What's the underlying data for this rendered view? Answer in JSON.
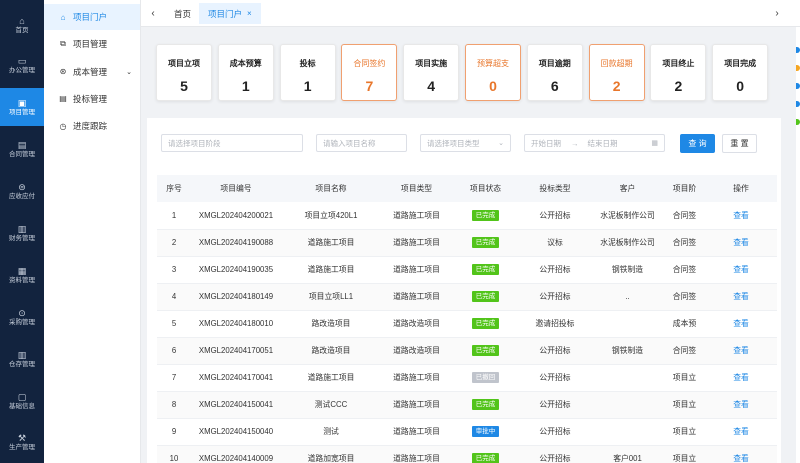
{
  "rail": [
    {
      "icon": "⌂",
      "label": "首页",
      "name": "rail-home",
      "icon_name": "home-icon"
    },
    {
      "icon": "▭",
      "label": "办公管理",
      "name": "rail-office",
      "icon_name": "monitor-icon"
    },
    {
      "icon": "▣",
      "label": "项目管理",
      "name": "rail-project",
      "icon_name": "project-icon",
      "active": true
    },
    {
      "icon": "▤",
      "label": "合同管理",
      "name": "rail-contract",
      "icon_name": "contract-icon"
    },
    {
      "icon": "⊜",
      "label": "应收应付",
      "name": "rail-receivable",
      "icon_name": "money-icon"
    },
    {
      "icon": "▥",
      "label": "财务管理",
      "name": "rail-finance",
      "icon_name": "finance-icon"
    },
    {
      "icon": "▦",
      "label": "资料管理",
      "name": "rail-documents",
      "icon_name": "folder-icon"
    },
    {
      "icon": "⊙",
      "label": "采购管理",
      "name": "rail-purchase",
      "icon_name": "purchase-icon"
    },
    {
      "icon": "▥",
      "label": "仓存管理",
      "name": "rail-warehouse",
      "icon_name": "warehouse-icon"
    },
    {
      "icon": "▢",
      "label": "基础信息",
      "name": "rail-basic",
      "icon_name": "info-icon"
    },
    {
      "icon": "⚒",
      "label": "生产管理",
      "name": "rail-production",
      "icon_name": "tool-icon"
    }
  ],
  "menu": [
    {
      "icon": "⌂",
      "label": "项目门户",
      "name": "menu-portal",
      "icon_name": "home-icon",
      "active": true
    },
    {
      "icon": "⧉",
      "label": "项目管理",
      "name": "menu-project",
      "icon_name": "copy-icon"
    },
    {
      "icon": "⊛",
      "label": "成本管理",
      "name": "menu-cost",
      "icon_name": "cost-icon",
      "chevron": "⌄"
    },
    {
      "icon": "▤",
      "label": "投标管理",
      "name": "menu-bidding",
      "icon_name": "bid-icon"
    },
    {
      "icon": "◷",
      "label": "进度跟踪",
      "name": "menu-progress",
      "icon_name": "clock-icon"
    }
  ],
  "tabs": {
    "left_arrow": "‹",
    "right_arrow": "›",
    "items": [
      {
        "label": "首页"
      },
      {
        "label": "项目门户",
        "close": "×",
        "active": true
      }
    ]
  },
  "kpis": [
    {
      "label": "项目立项",
      "value": "5"
    },
    {
      "label": "成本预算",
      "value": "1"
    },
    {
      "label": "投标",
      "value": "1"
    },
    {
      "label": "合同签约",
      "value": "7",
      "warn": true
    },
    {
      "label": "项目实施",
      "value": "4"
    },
    {
      "label": "预算超支",
      "value": "0",
      "warn": true
    },
    {
      "label": "项目逾期",
      "value": "6"
    },
    {
      "label": "回款超期",
      "value": "2",
      "warn": true
    },
    {
      "label": "项目终止",
      "value": "2"
    },
    {
      "label": "项目完成",
      "value": "0"
    }
  ],
  "filters": {
    "stage_placeholder": "请选择项目阶段",
    "name_placeholder": "请输入项目名称",
    "type_placeholder": "请选择项目类型",
    "type_caret": "⌄",
    "start_placeholder": "开始日期",
    "range_arrow": "→",
    "end_placeholder": "结束日期",
    "calendar_icon": "▦",
    "search_label": "查 询",
    "reset_label": "重 置"
  },
  "table": {
    "headers": [
      "序号",
      "项目编号",
      "项目名称",
      "项目类型",
      "项目状态",
      "投标类型",
      "客户",
      "项目阶",
      "操作"
    ],
    "rows": [
      {
        "no": "1",
        "code": "XMGL202404200021",
        "name": "项目立项420L1",
        "type": "道路施工项目",
        "status": "已完成",
        "status_color": "#52c41a",
        "bid": "公开招标",
        "customer": "水泥板制作公司",
        "stage": "合同签",
        "op": "查看"
      },
      {
        "no": "2",
        "code": "XMGL202404190088",
        "name": "道路施工项目",
        "type": "道路施工项目",
        "status": "已完成",
        "status_color": "#52c41a",
        "bid": "议标",
        "customer": "水泥板制作公司",
        "stage": "合同签",
        "op": "查看"
      },
      {
        "no": "3",
        "code": "XMGL202404190035",
        "name": "道路施工项目",
        "type": "道路施工项目",
        "status": "已完成",
        "status_color": "#52c41a",
        "bid": "公开招标",
        "customer": "钢铁制造",
        "stage": "合同签",
        "op": "查看"
      },
      {
        "no": "4",
        "code": "XMGL202404180149",
        "name": "项目立项LL1",
        "type": "道路施工项目",
        "status": "已完成",
        "status_color": "#52c41a",
        "bid": "公开招标",
        "customer": "..",
        "stage": "合同签",
        "op": "查看"
      },
      {
        "no": "5",
        "code": "XMGL202404180010",
        "name": "路改造项目",
        "type": "道路改造项目",
        "status": "已完成",
        "status_color": "#52c41a",
        "bid": "邀请招投标",
        "customer": "",
        "stage": "成本预",
        "op": "查看"
      },
      {
        "no": "6",
        "code": "XMGL202404170051",
        "name": "路改造项目",
        "type": "道路改造项目",
        "status": "已完成",
        "status_color": "#52c41a",
        "bid": "公开招标",
        "customer": "钢铁制造",
        "stage": "合同签",
        "op": "查看"
      },
      {
        "no": "7",
        "code": "XMGL202404170041",
        "name": "道路施工项目",
        "type": "道路施工项目",
        "status": "已撤回",
        "status_color": "#c0c4cc",
        "bid": "公开招标",
        "customer": "",
        "stage": "项目立",
        "op": "查看"
      },
      {
        "no": "8",
        "code": "XMGL202404150041",
        "name": "测试CCC",
        "type": "道路施工项目",
        "status": "已完成",
        "status_color": "#52c41a",
        "bid": "公开招标",
        "customer": "",
        "stage": "项目立",
        "op": "查看"
      },
      {
        "no": "9",
        "code": "XMGL202404150040",
        "name": "测试",
        "type": "道路施工项目",
        "status": "审批中",
        "status_color": "#1e88e5",
        "bid": "公开招标",
        "customer": "",
        "stage": "项目立",
        "op": "查看"
      },
      {
        "no": "10",
        "code": "XMGL202404140009",
        "name": "道路加宽项目",
        "type": "道路施工项目",
        "status": "已完成",
        "status_color": "#52c41a",
        "bid": "公开招标",
        "customer": "客户001",
        "stage": "项目立",
        "op": "查看"
      }
    ]
  },
  "colors": {
    "accent": "#1e88e5",
    "warning": "#e8762b",
    "success": "#52c41a",
    "rail_bg": "#12233e"
  },
  "rightbar_dots": [
    {
      "color": "#1e88e5"
    },
    {
      "color": "#f5a623"
    },
    {
      "color": "#1e88e5"
    },
    {
      "color": "#1e88e5"
    },
    {
      "color": "#52c41a"
    }
  ]
}
